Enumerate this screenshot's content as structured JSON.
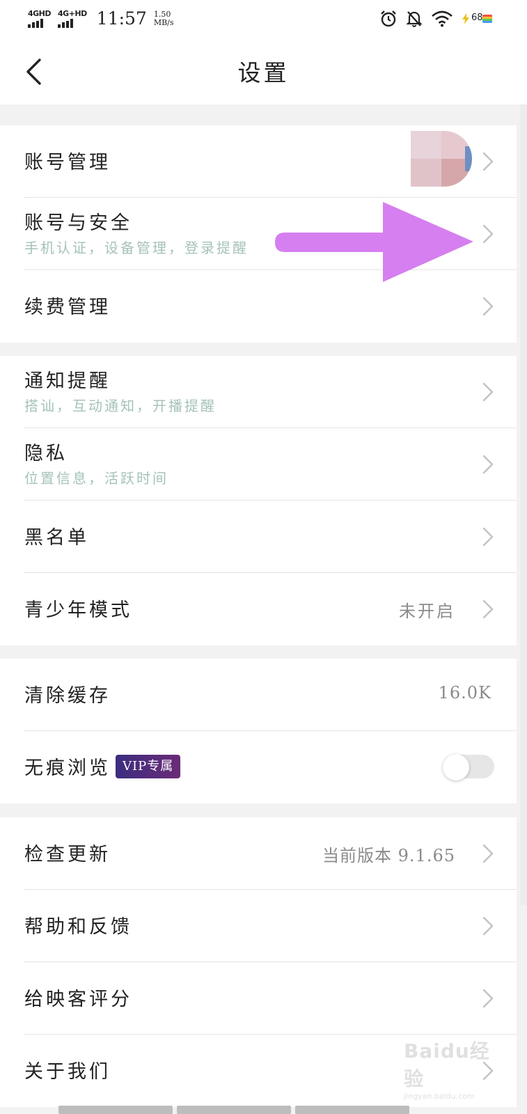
{
  "status_bar": {
    "signal1_label": "4GHD",
    "signal2_label": "4G+HD",
    "time": "11:57",
    "speed_value": "1.50",
    "speed_unit": "MB/s",
    "battery_level": "68",
    "icons": [
      "alarm-icon",
      "bell-off-icon",
      "wifi-icon",
      "charging-bolt-icon"
    ]
  },
  "nav": {
    "title": "设置",
    "back_icon": "chevron-left-icon"
  },
  "sections": {
    "account": {
      "account_manage": {
        "title": "账号管理"
      },
      "account_security": {
        "title": "账号与安全",
        "subtitle": "手机认证，设备管理，登录提醒"
      },
      "renewal": {
        "title": "续费管理"
      }
    },
    "privacy": {
      "notifications": {
        "title": "通知提醒",
        "subtitle": "搭讪，互动通知，开播提醒"
      },
      "privacy": {
        "title": "隐私",
        "subtitle": "位置信息，活跃时间"
      },
      "blacklist": {
        "title": "黑名单"
      },
      "teen_mode": {
        "title": "青少年模式",
        "value": "未开启"
      }
    },
    "storage": {
      "clear_cache": {
        "title": "清除缓存",
        "value": "16.0K"
      },
      "incognito": {
        "title": "无痕浏览",
        "badge": "VIP专属",
        "toggle_on": false
      }
    },
    "about": {
      "check_update": {
        "title": "检查更新",
        "value": "当前版本 9.1.65"
      },
      "help_feedback": {
        "title": "帮助和反馈"
      },
      "rate_app": {
        "title": "给映客评分"
      },
      "about_us": {
        "title": "关于我们"
      }
    }
  },
  "colors": {
    "arrow": "#d67ff0",
    "vip_badge_start": "#3c2d80",
    "vip_badge_end": "#6a2b78",
    "subtitle": "#a5c2b9",
    "section_gap": "#f2f2f2"
  },
  "watermark": {
    "text": "Baidu经验",
    "url": "jingyan.baidu.com"
  }
}
